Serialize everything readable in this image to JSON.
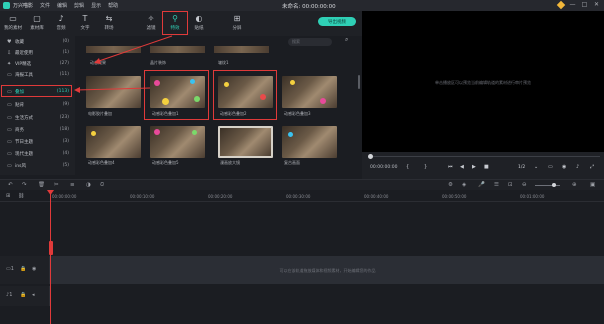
{
  "titlebar": {
    "app_name": "万兴喵影",
    "menu": [
      "文件",
      "编辑",
      "剪辑",
      "显示",
      "帮助"
    ],
    "doc_title": "未命名: 00:00:00:00",
    "controls": [
      "—",
      "□",
      "✕"
    ]
  },
  "toolbar": {
    "tools": [
      {
        "icon": "media-icon",
        "glyph": "▭",
        "label": "我的素材"
      },
      {
        "icon": "stock-icon",
        "glyph": "▢",
        "label": "素材库"
      },
      {
        "icon": "audio-icon",
        "glyph": "♪",
        "label": "音频"
      },
      {
        "icon": "text-icon",
        "glyph": "T",
        "label": "文字"
      },
      {
        "icon": "transition-icon",
        "glyph": "⇆",
        "label": "转场"
      },
      {
        "icon": "effects-icon",
        "glyph": "✧",
        "label": "滤镜"
      },
      {
        "icon": "overlay-icon",
        "glyph": "⚲",
        "label": "特效"
      },
      {
        "icon": "sticker-icon",
        "glyph": "◐",
        "label": "贴纸"
      },
      {
        "icon": "split-icon",
        "glyph": "⊞",
        "label": "分屏"
      }
    ],
    "export_label": "导出视频"
  },
  "sidebar": {
    "items": [
      {
        "icon": "heart-icon",
        "glyph": "♥",
        "label": "收藏",
        "count": "(0)"
      },
      {
        "icon": "download-icon",
        "glyph": "⇩",
        "label": "最近使用",
        "count": "(1)"
      },
      {
        "icon": "star-icon",
        "glyph": "✦",
        "label": "VIP精选",
        "count": "(27)"
      },
      {
        "icon": "folder-icon",
        "glyph": "▭",
        "label": "海报工具",
        "count": "(11)"
      },
      {
        "icon": "folder-icon",
        "glyph": "▭",
        "label": "叠加",
        "count": "(113)",
        "active": true
      },
      {
        "icon": "folder-icon",
        "glyph": "▭",
        "label": "贴背",
        "count": "(9)"
      },
      {
        "icon": "folder-icon",
        "glyph": "▭",
        "label": "生活方式",
        "count": "(23)"
      },
      {
        "icon": "folder-icon",
        "glyph": "▭",
        "label": "商务",
        "count": "(18)"
      },
      {
        "icon": "folder-icon",
        "glyph": "▭",
        "label": "节日主题",
        "count": "(3)"
      },
      {
        "icon": "folder-icon",
        "glyph": "▭",
        "label": "现代主题",
        "count": "(4)"
      },
      {
        "icon": "folder-icon",
        "glyph": "▭",
        "label": "ins风",
        "count": "(5)"
      }
    ]
  },
  "grid": {
    "search_placeholder": "搜索",
    "top_row_labels": [
      "动态效果",
      "晶片装饰",
      "皱纹1"
    ],
    "rows": [
      [
        "电影胶片叠加",
        "动感彩色叠加1",
        "动感彩色叠加2",
        "动感彩色叠加3"
      ],
      [
        "动感彩色叠加4",
        "动感彩色叠加5",
        "漫画放大镜",
        "复古画面"
      ]
    ]
  },
  "preview": {
    "message": "单击播放区可以预览当前编辑轨道的素材进行审片预览",
    "time_current": "00:00:00:00",
    "ratio": "1/2"
  },
  "timeline": {
    "ticks": [
      "00:00:00:00",
      "00:00:10:00",
      "00:00:20:00",
      "00:00:30:00",
      "00:00:40:00",
      "00:00:50:00",
      "00:01:00:00"
    ],
    "video_track_message": "可以在该轨道拖放媒体和视频素材，开始编辑您的作品"
  },
  "colors": {
    "accent": "#2fd0b6",
    "highlight": "#e03a3a",
    "background": "#1b1d22"
  }
}
